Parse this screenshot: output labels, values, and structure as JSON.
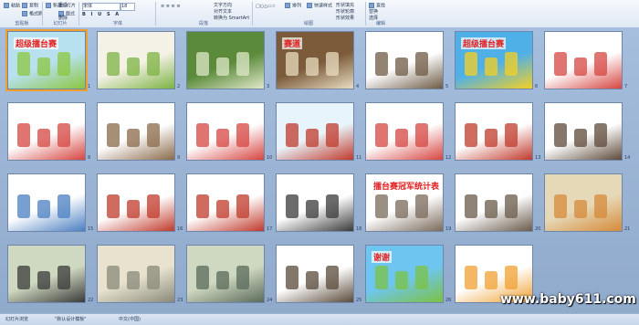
{
  "ribbon": {
    "left_buttons": [
      "粘贴",
      "复制",
      "格式刷"
    ],
    "new_slide": "新建幻灯片",
    "layout": "版式",
    "reset": "重设",
    "delete": "删除",
    "font_name": "宋体",
    "font_size": "18",
    "shapes": "形状",
    "arrange": "排列",
    "quick_styles": "快速样式",
    "shape_fill": "形状填充",
    "shape_outline": "形状轮廓",
    "shape_effects": "形状效果",
    "find": "查找",
    "replace": "替换",
    "select": "选择",
    "text_direction": "文字方向",
    "align_text": "对齐文本",
    "smartart": "转换为 SmartArt",
    "groups": [
      "剪贴板",
      "幻灯片",
      "字体",
      "段落",
      "绘图",
      "编辑"
    ]
  },
  "slides": [
    {
      "num": "1",
      "title": "超级擂台赛",
      "selected": true
    },
    {
      "num": "2"
    },
    {
      "num": "3"
    },
    {
      "num": "4",
      "title": "赛道"
    },
    {
      "num": "5"
    },
    {
      "num": "6",
      "title": "超级擂台赛"
    },
    {
      "num": "7"
    },
    {
      "num": "8"
    },
    {
      "num": "9"
    },
    {
      "num": "10"
    },
    {
      "num": "11"
    },
    {
      "num": "12"
    },
    {
      "num": "13"
    },
    {
      "num": "14"
    },
    {
      "num": "15"
    },
    {
      "num": "16"
    },
    {
      "num": "17"
    },
    {
      "num": "18"
    },
    {
      "num": "19",
      "title": "擂台赛冠军统计表"
    },
    {
      "num": "20"
    },
    {
      "num": "21"
    },
    {
      "num": "22"
    },
    {
      "num": "23"
    },
    {
      "num": "24"
    },
    {
      "num": "25"
    },
    {
      "num": "26",
      "title": "谢谢"
    },
    {
      "num": "27"
    }
  ],
  "status": {
    "view": "幻灯片浏览",
    "theme": "\"默认设计模板\"",
    "language": "中文(中国)"
  },
  "watermark": "www.baby611.com",
  "colors": {
    "sorter_bg": "#9fb7d6",
    "selected_outline": "#f0a030",
    "ribbon_bg": "#e4ecf7"
  }
}
